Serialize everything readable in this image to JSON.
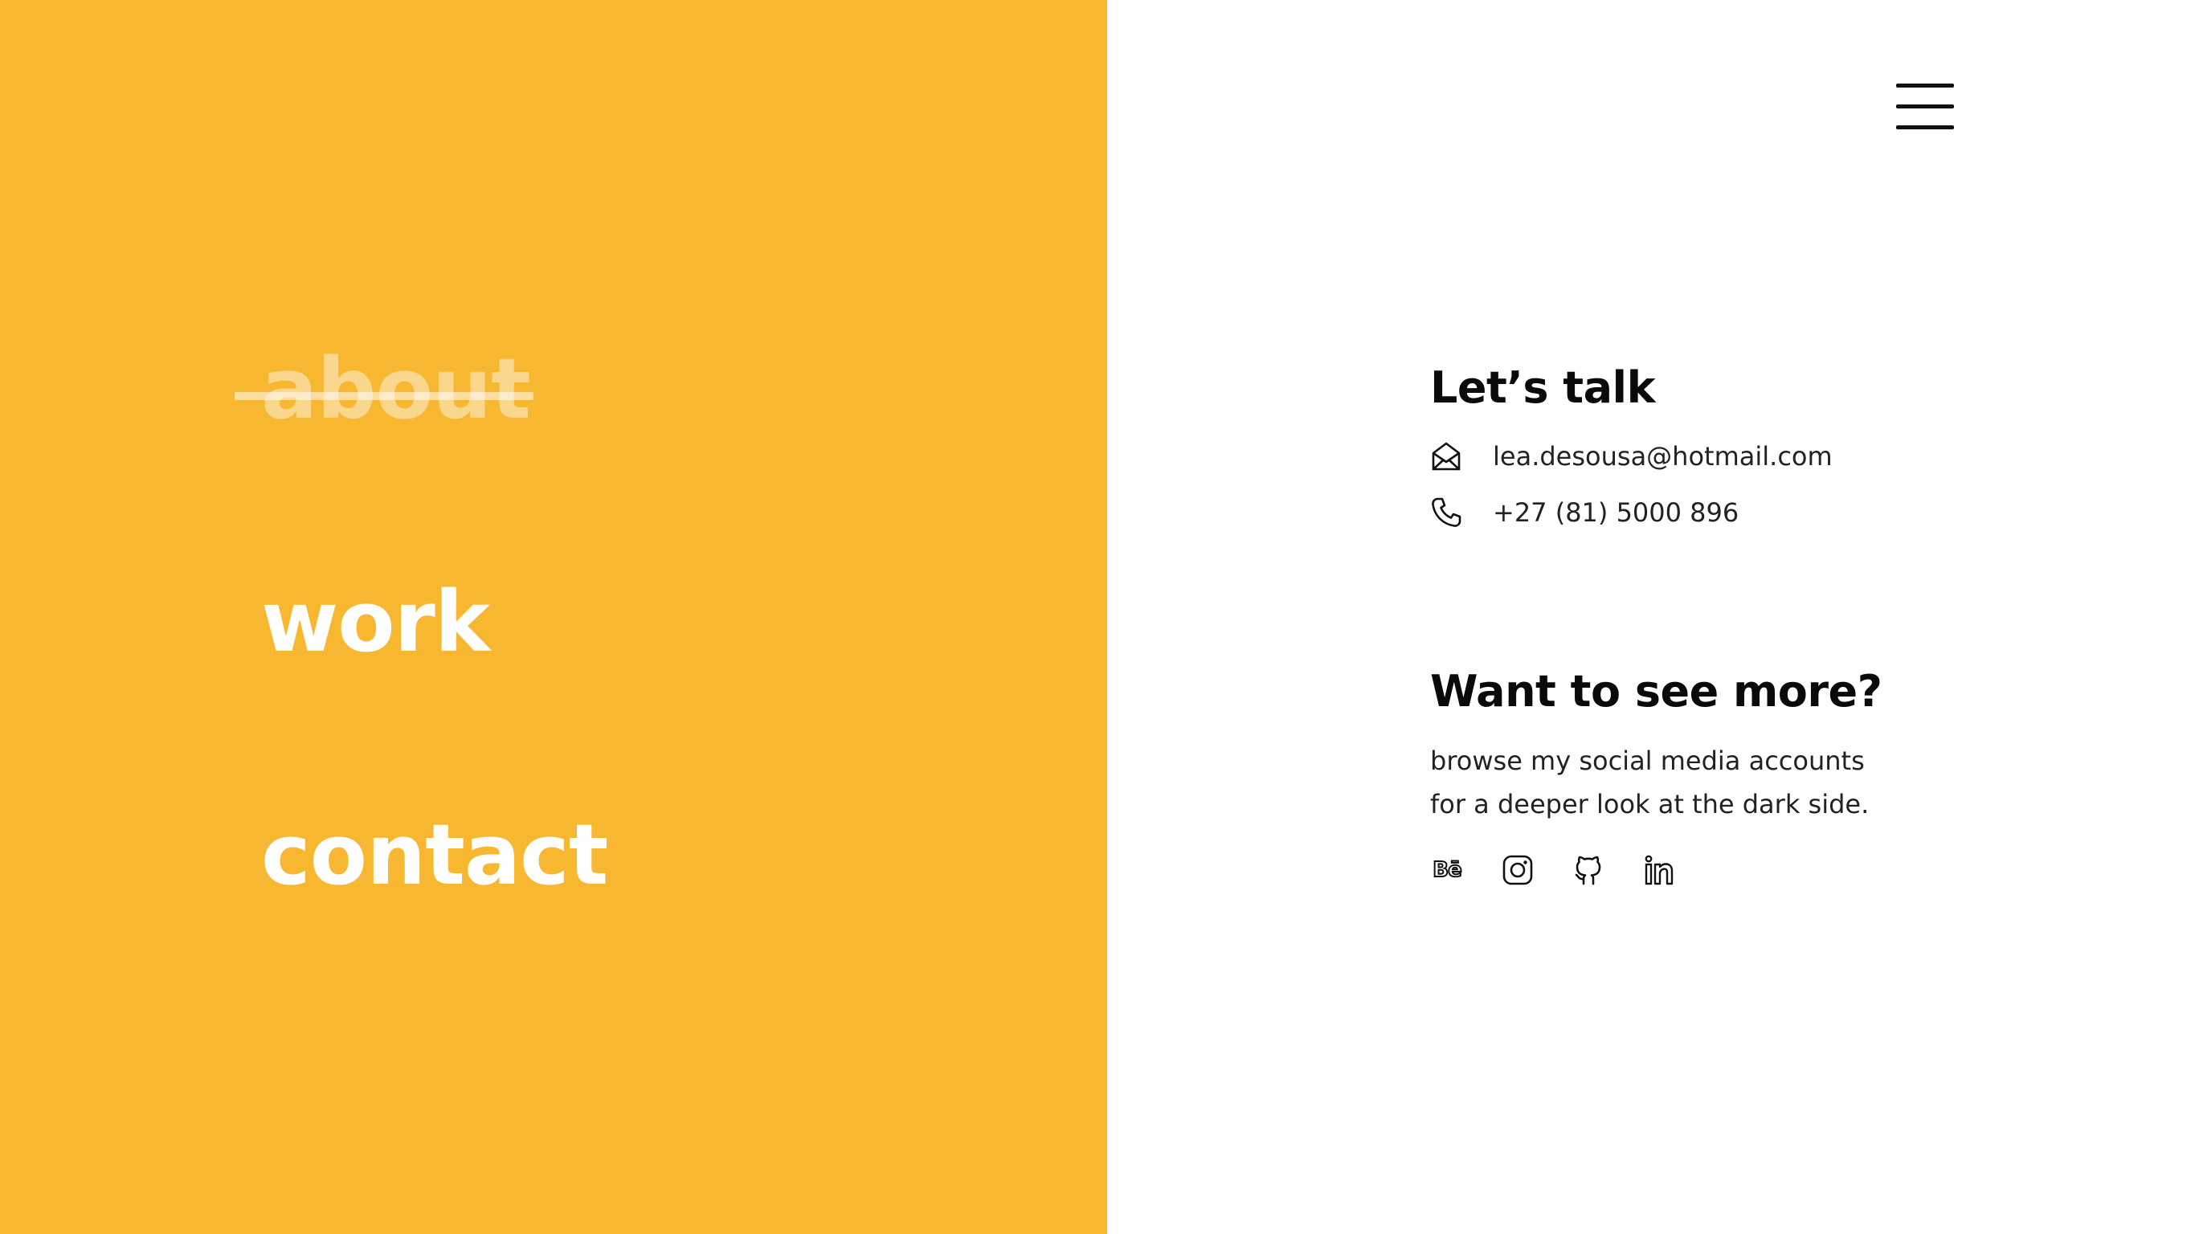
{
  "nav": {
    "items": [
      {
        "label": "about",
        "state": "visited"
      },
      {
        "label": "work",
        "state": "default"
      },
      {
        "label": "contact",
        "state": "default"
      }
    ],
    "background_color": "#F8B731",
    "text_color": "#FFFFFF"
  },
  "header": {
    "menu_icon": "hamburger-menu-icon"
  },
  "contact_section": {
    "title": "Let’s talk",
    "email": {
      "icon": "envelope-icon",
      "text": "lea.desousa@hotmail.com"
    },
    "phone": {
      "icon": "phone-icon",
      "text": "+27 (81) 5000 896"
    }
  },
  "social_section": {
    "title": "Want to see more?",
    "description_lines": [
      "browse my social media accounts",
      "for a deeper look at the dark side."
    ],
    "links": [
      {
        "icon": "behance-icon",
        "glyph": "Bē"
      },
      {
        "icon": "instagram-icon"
      },
      {
        "icon": "github-icon"
      },
      {
        "icon": "linkedin-icon"
      }
    ]
  }
}
